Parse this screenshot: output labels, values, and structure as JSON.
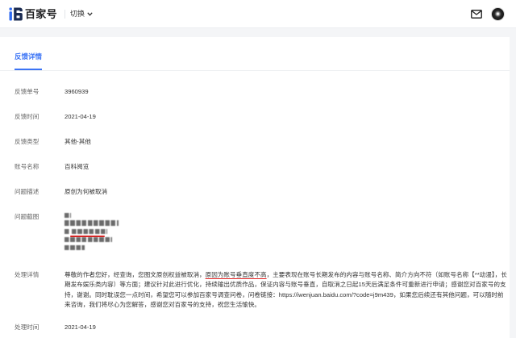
{
  "header": {
    "brand": "百家号",
    "switch_label": "切换"
  },
  "icons": {
    "logo": "baijiahao-logo-icon",
    "switch": "chevron-down-icon",
    "mail": "mail-icon",
    "avatar": "user-avatar"
  },
  "colors": {
    "accent": "#3c74f5",
    "annotation": "#e02424",
    "label_text": "#666666",
    "body_text": "#333333",
    "page_bg": "#f4f5f7"
  },
  "tabs": [
    {
      "label": "反馈详情",
      "active": true
    }
  ],
  "details": {
    "rows": [
      {
        "label": "反馈单号",
        "value": "3960939"
      },
      {
        "label": "反馈时间",
        "value": "2021-04-19"
      },
      {
        "label": "反馈类型",
        "value": "其他-其他"
      },
      {
        "label": "账号名称",
        "value": "百科阅览"
      },
      {
        "label": "问题描述",
        "value": "原创为何被取消"
      }
    ],
    "screenshot": {
      "label": "问题截图"
    },
    "processing": {
      "label": "处理详情",
      "parts": [
        "尊敬的作者您好，经查询，您图文原创权益被取消，",
        "原因为账号垂直度不高",
        "，主要表现在账号长期发布的内容与账号名称、简介方向不符（如账号名称【**动漫】，长期发布娱乐类内容）等方面；建议针对此进行优化，持续输出优质作品，保证内容与账号垂直，自取消之日起15天后满足条件可重新进行申请；感谢您对百家号的支持，谢谢。同时耽误您一点时间，希望您可以参加百家号调查问卷，问卷链接：https://iwenjuan.baidu.com/?code=j9m439，如果您后续还有其他问题，可以随时前来咨询，我们将尽心为您解答，感谢您对百家号的支持，祝您生活愉快。"
      ]
    },
    "processed_time": {
      "label": "处理时间",
      "value": "2021-04-19"
    }
  }
}
